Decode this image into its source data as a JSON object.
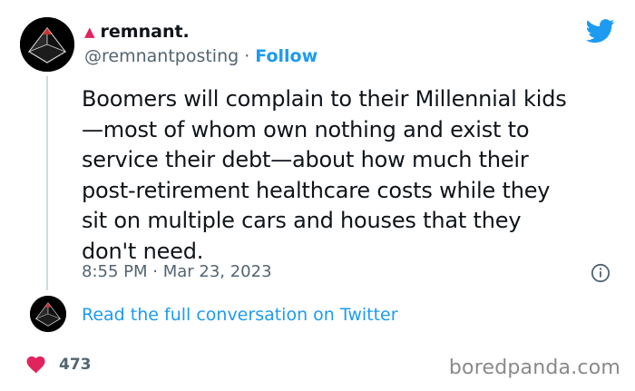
{
  "author": {
    "display_name": "remnant.",
    "handle": "@remnantposting",
    "separator": "·",
    "follow_label": "Follow"
  },
  "tweet": {
    "text": "Boomers will complain to their Millennial kids\n—most of whom own nothing and exist to\nservice their debt—about how much their\npost-retirement healthcare costs while they\nsit on multiple cars and houses that they\ndon't need.",
    "timestamp": "8:55 PM · Mar 23, 2023"
  },
  "conversation_link": "Read the full conversation on Twitter",
  "likes": {
    "count": "473"
  },
  "watermark": "boredpanda.com",
  "colors": {
    "accent": "#1d9bf0",
    "heart": "#e0245e",
    "triangle": "#e0245e",
    "muted_text": "#536471"
  },
  "icons": [
    "avatar",
    "twitter-bird-icon",
    "info-icon",
    "heart-icon",
    "triangle-icon"
  ]
}
